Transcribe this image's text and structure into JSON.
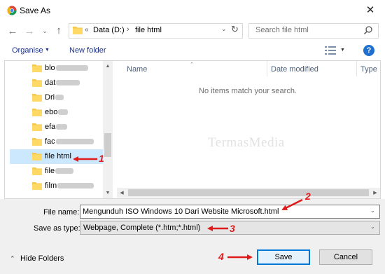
{
  "window": {
    "title": "Save As"
  },
  "address": {
    "segments": [
      "Data (D:)",
      "file html"
    ]
  },
  "search": {
    "placeholder": "Search file html"
  },
  "toolbar": {
    "organise": "Organise",
    "new_folder": "New folder"
  },
  "nav": {
    "items": [
      {
        "label": "blo",
        "blurred": true
      },
      {
        "label": "dat",
        "blurred": true
      },
      {
        "label": "Dri",
        "blurred": true
      },
      {
        "label": "ebo",
        "blurred": true
      },
      {
        "label": "efa",
        "blurred": true
      },
      {
        "label": "fac",
        "blurred": true
      },
      {
        "label": "file html",
        "selected": true
      },
      {
        "label": "file",
        "blurred": true
      },
      {
        "label": "film",
        "blurred": true
      }
    ]
  },
  "list": {
    "columns": [
      "Name",
      "Date modified",
      "Type"
    ],
    "empty_message": "No items match your search."
  },
  "watermark": "TermasMedia",
  "form": {
    "filename_label": "File name:",
    "filename_value": "Mengunduh ISO Windows 10 Dari Website Microsoft.html",
    "savetype_label": "Save as type:",
    "savetype_value": "Webpage, Complete (*.htm;*.html)"
  },
  "footer": {
    "hide_folders": "Hide Folders",
    "save": "Save",
    "cancel": "Cancel"
  },
  "annotations": {
    "step1": "1",
    "step2": "2",
    "step3": "3",
    "step4": "4"
  },
  "colors": {
    "accent": "#0078d7",
    "annotation": "#e01b1b",
    "folder": "#f6c94a",
    "link": "#1e3287"
  }
}
